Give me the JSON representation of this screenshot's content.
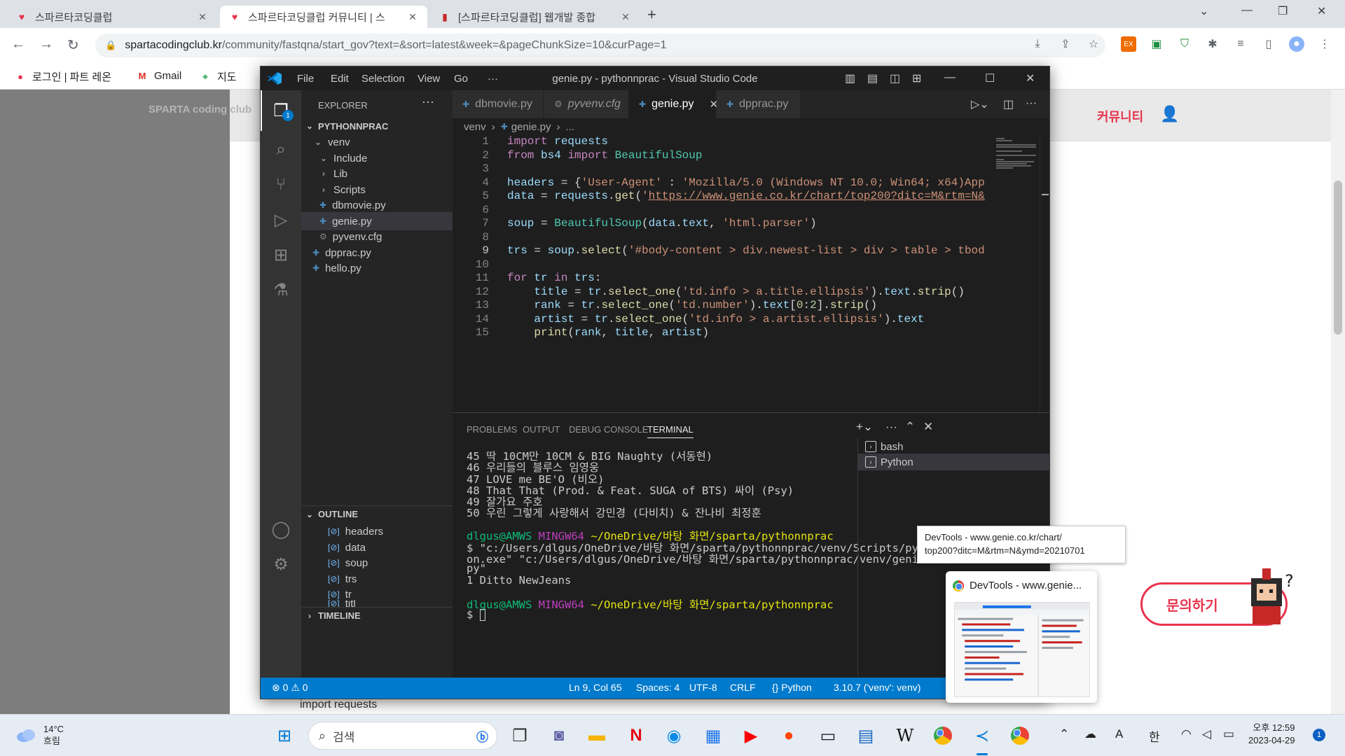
{
  "browser": {
    "tabs": [
      {
        "title": "스파르타코딩클럽",
        "icon": "sparta-heart-icon",
        "active": false
      },
      {
        "title": "스파르타코딩클럽 커뮤니티 | 스",
        "icon": "sparta-heart-icon",
        "active": true
      },
      {
        "title": "[스파르타코딩클럽] 웹개발 종합",
        "icon": "book-icon",
        "active": false
      }
    ],
    "url_host": "spartacodingclub.kr",
    "url_rest": "/community/fastqna/start_gov?text=&sort=latest&week=&pageChunkSize=10&curPage=1",
    "bookmarks": [
      {
        "label": "로그인 | 파트 레온",
        "icon": "patreon-icon"
      },
      {
        "label": "Gmail",
        "icon": "gmail-icon"
      },
      {
        "label": "지도",
        "icon": "maps-icon"
      }
    ]
  },
  "site": {
    "logo": "SPARTA coding club",
    "nav_community": "커뮤니티",
    "inquiry_button": "문의하기",
    "snippet": "import requests"
  },
  "vscode": {
    "title": "genie.py - pythonnprac - Visual Studio Code",
    "menu": [
      "File",
      "Edit",
      "Selection",
      "View",
      "Go",
      "···"
    ],
    "explorer_label": "EXPLORER",
    "explorer_badge": "1",
    "project": "PYTHONNPRAC",
    "tree": [
      {
        "label": "venv",
        "type": "folder-open",
        "indent": 1
      },
      {
        "label": "Include",
        "type": "folder-open",
        "indent": 2
      },
      {
        "label": "Lib",
        "type": "folder",
        "indent": 2
      },
      {
        "label": "Scripts",
        "type": "folder",
        "indent": 2
      },
      {
        "label": "dbmovie.py",
        "type": "py",
        "indent": 2
      },
      {
        "label": "genie.py",
        "type": "py",
        "indent": 2,
        "selected": true
      },
      {
        "label": "pyvenv.cfg",
        "type": "cfg",
        "indent": 2
      },
      {
        "label": "dpprac.py",
        "type": "py",
        "indent": 1
      },
      {
        "label": "hello.py",
        "type": "py",
        "indent": 1
      }
    ],
    "outline_label": "OUTLINE",
    "outline": [
      "headers",
      "data",
      "soup",
      "trs",
      "tr",
      "titl"
    ],
    "timeline_label": "TIMELINE",
    "tabs": [
      {
        "label": "dbmovie.py",
        "icon": "py"
      },
      {
        "label": "pyvenv.cfg",
        "icon": "cfg",
        "italic": true
      },
      {
        "label": "genie.py",
        "icon": "py",
        "active": true
      },
      {
        "label": "dpprac.py",
        "icon": "py",
        "dirty": true
      }
    ],
    "breadcrumb": [
      "venv",
      "genie.py",
      "..."
    ],
    "code_lines": [
      "import requests",
      "from bs4 import BeautifulSoup",
      "",
      "headers = {'User-Agent' : 'Mozilla/5.0 (Windows NT 10.0; Win64; x64)App",
      "data = requests.get('https://www.genie.co.kr/chart/top200?ditc=M&rtm=N&",
      "",
      "soup = BeautifulSoup(data.text, 'html.parser')",
      "",
      "trs = soup.select('#body-content > div.newest-list > div > table > tbod",
      "",
      "for tr in trs:",
      "    title = tr.select_one('td.info > a.title.ellipsis').text.strip()",
      "    rank = tr.select_one('td.number').text[0:2].strip()",
      "    artist = tr.select_one('td.info > a.artist.ellipsis').text",
      "    print(rank, title, artist)"
    ],
    "current_line": 9,
    "panel_tabs": [
      "PROBLEMS",
      "OUTPUT",
      "DEBUG CONSOLE",
      "TERMINAL"
    ],
    "terminal_output": [
      "45 딱 10CM만 10CM & BIG Naughty (서동현)",
      "46 우리들의 블루스 임영웅",
      "47 LOVE me BE'O (비오)",
      "48 That That (Prod. & Feat. SUGA of BTS) 싸이 (Psy)",
      "49 잘가요 주호",
      "50 우린 그렇게 사랑해서 강민경 (다비치) & 잔나비 최정훈"
    ],
    "prompt_user": "dlgus@AMWS",
    "prompt_shell": "MINGW64",
    "prompt_path": "~/OneDrive/바탕 화면/sparta/pythonnprac",
    "command_lines": [
      "$ \"c:/Users/dlgus/OneDrive/바탕 화면/sparta/pythonnprac/venv/Scripts/pyth",
      "on.exe\" \"c:/Users/dlgus/OneDrive/바탕 화면/sparta/pythonnprac/venv/genie.",
      "py\""
    ],
    "result_line": "1 Ditto NewJeans",
    "prompt_symbol": "$",
    "terminals": [
      {
        "label": "bash",
        "selected": false
      },
      {
        "label": "Python",
        "selected": true
      }
    ],
    "status": {
      "errors": "0",
      "warnings": "0",
      "position": "Ln 9, Col 65",
      "spaces": "Spaces: 4",
      "encoding": "UTF-8",
      "eol": "CRLF",
      "language": "Python",
      "interpreter": "3.10.7 ('venv': venv)"
    }
  },
  "tooltip": {
    "line1": "DevTools - www.genie.co.kr/chart/",
    "line2": "top200?ditc=M&rtm=N&ymd=20210701"
  },
  "preview": {
    "title": "DevTools - www.genie..."
  },
  "taskbar": {
    "temp": "14°C",
    "weather": "흐림",
    "search": "검색",
    "time": "오후 12:59",
    "date": "2023-04-29",
    "notifications": "1",
    "lang": "한"
  },
  "colors": {
    "accent_blue": "#007acc",
    "sparta_red": "#e8344e"
  }
}
